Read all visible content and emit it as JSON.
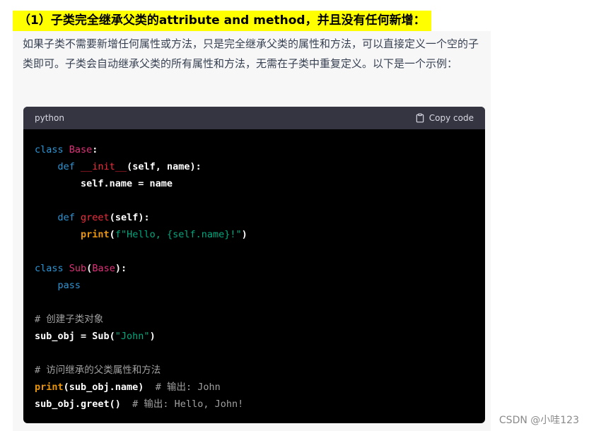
{
  "heading": "（1）子类完全继承父类的attribute and method，并且没有任何新增：",
  "paragraph": "如果子类不需要新增任何属性或方法，只是完全继承父类的属性和方法，可以直接定义一个空的子类即可。子类会自动继承父类的所有属性和方法，无需在子类中重复定义。以下是一个示例：",
  "code_block": {
    "language": "python",
    "copy_label": "Copy code",
    "copy_icon": "clipboard-icon",
    "lines": [
      "class Base:",
      "    def __init__(self, name):",
      "        self.name = name",
      "",
      "    def greet(self):",
      "        print(f\"Hello, {self.name}!\")",
      "",
      "class Sub(Base):",
      "    pass",
      "",
      "# 创建子类对象",
      "sub_obj = Sub(\"John\")",
      "",
      "# 访问继承的父类属性和方法",
      "print(sub_obj.name)  # 输出: John",
      "sub_obj.greet()  # 输出: Hello, John!"
    ]
  },
  "watermark": "CSDN @小哇123",
  "colors": {
    "highlight": "#ffff00",
    "keyword": "#2e95d3",
    "class_name": "#df3079",
    "function_name": "#f22c3d",
    "builtin": "#e9950c",
    "string": "#00a67d",
    "comment": "#a0a0a0"
  }
}
